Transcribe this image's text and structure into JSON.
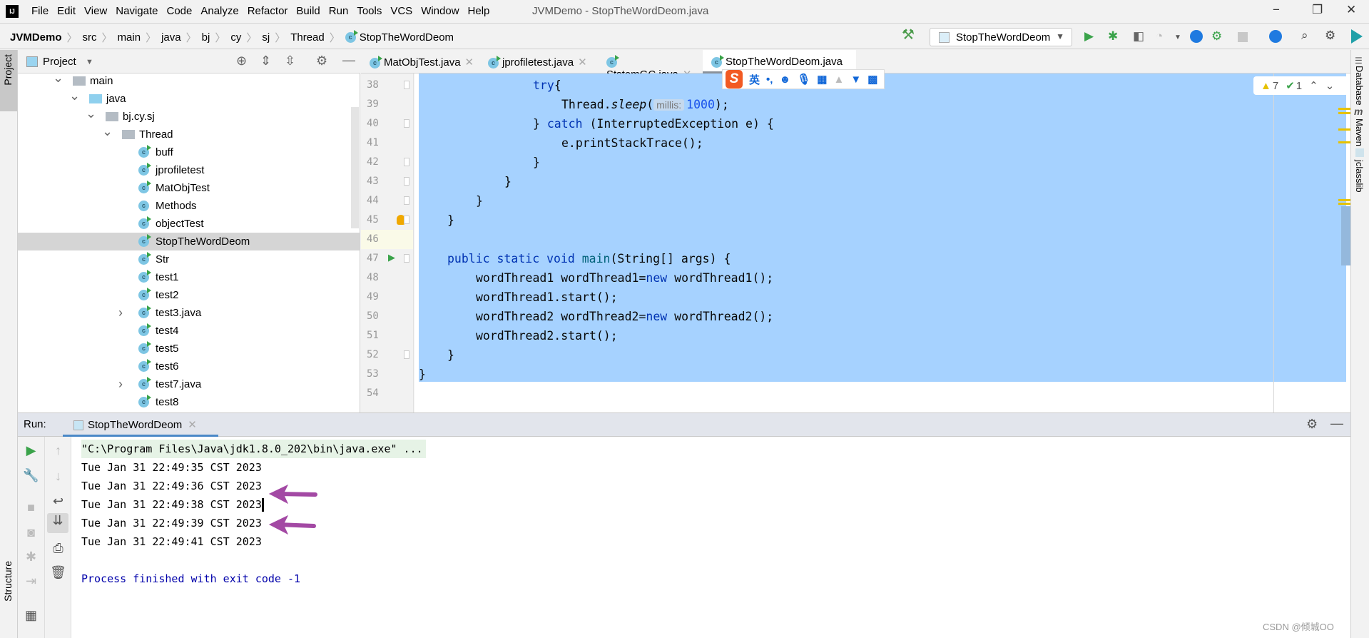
{
  "app": {
    "logo": "IJ",
    "title": "JVMDemo - StopTheWordDeom.java"
  },
  "menu": [
    "File",
    "Edit",
    "View",
    "Navigate",
    "Code",
    "Analyze",
    "Refactor",
    "Build",
    "Run",
    "Tools",
    "VCS",
    "Window",
    "Help"
  ],
  "window_controls": {
    "minimize": "−",
    "restore": "❐",
    "close": "✕"
  },
  "breadcrumb": [
    "JVMDemo",
    "src",
    "main",
    "java",
    "bj",
    "cy",
    "sj",
    "Thread",
    "StopTheWordDeom"
  ],
  "toolbar": {
    "run_config": "StopTheWordDeom",
    "icons": [
      "hammer-icon",
      "run-icon",
      "debug-icon",
      "coverage-icon",
      "profile-icon",
      "stop-icon",
      "search-icon",
      "gear-icon"
    ]
  },
  "left_strip": {
    "project": "Project",
    "structure": "Structure"
  },
  "project": {
    "title": "Project",
    "tree": [
      {
        "label": "main",
        "level": 0,
        "type": "folder",
        "expanded": true
      },
      {
        "label": "java",
        "level": 1,
        "type": "src",
        "expanded": true
      },
      {
        "label": "bj.cy.sj",
        "level": 2,
        "type": "package",
        "expanded": true
      },
      {
        "label": "Thread",
        "level": 3,
        "type": "package",
        "expanded": true
      },
      {
        "label": "buff",
        "level": 4,
        "type": "class"
      },
      {
        "label": "jprofiletest",
        "level": 4,
        "type": "class"
      },
      {
        "label": "MatObjTest",
        "level": 4,
        "type": "class"
      },
      {
        "label": "Methods",
        "level": 4,
        "type": "plain"
      },
      {
        "label": "objectTest",
        "level": 4,
        "type": "class"
      },
      {
        "label": "StopTheWordDeom",
        "level": 4,
        "type": "class",
        "selected": true
      },
      {
        "label": "Str",
        "level": 4,
        "type": "class"
      },
      {
        "label": "test1",
        "level": 4,
        "type": "class"
      },
      {
        "label": "test2",
        "level": 4,
        "type": "class"
      },
      {
        "label": "test3.java",
        "level": 4,
        "type": "class",
        "collapsed": true
      },
      {
        "label": "test4",
        "level": 4,
        "type": "class"
      },
      {
        "label": "test5",
        "level": 4,
        "type": "class"
      },
      {
        "label": "test6",
        "level": 4,
        "type": "class"
      },
      {
        "label": "test7.java",
        "level": 4,
        "type": "class",
        "collapsed": true
      },
      {
        "label": "test8",
        "level": 4,
        "type": "class"
      }
    ]
  },
  "editor": {
    "tabs": [
      {
        "label": "MatObjTest.java",
        "active": false
      },
      {
        "label": "jprofiletest.java",
        "active": false
      },
      {
        "label": "StstemGC.java",
        "active": false
      },
      {
        "label": "StopTheWordDeom.java",
        "active": true
      }
    ],
    "ime_bar": {
      "mode": "英",
      "punct": "•,"
    },
    "inspections": {
      "warnings": "7",
      "weak_warnings": "1"
    },
    "lines": [
      {
        "n": "38",
        "indent": 4,
        "tokens": [
          [
            "kw",
            "try"
          ],
          [
            "",
            "{"
          ]
        ]
      },
      {
        "n": "39",
        "indent": 5,
        "tokens": [
          [
            "",
            "Thread."
          ],
          [
            "it",
            "sleep"
          ],
          [
            "",
            "("
          ],
          [
            "hint",
            "millis:"
          ],
          [
            "num",
            "1000"
          ],
          [
            "",
            ");"
          ]
        ]
      },
      {
        "n": "40",
        "indent": 4,
        "tokens": [
          [
            "",
            "} "
          ],
          [
            "kw",
            "catch"
          ],
          [
            "",
            " (InterruptedException e) {"
          ]
        ]
      },
      {
        "n": "41",
        "indent": 5,
        "tokens": [
          [
            "",
            "e.printStackTrace();"
          ]
        ]
      },
      {
        "n": "42",
        "indent": 4,
        "tokens": [
          [
            "",
            "}"
          ]
        ]
      },
      {
        "n": "43",
        "indent": 3,
        "tokens": [
          [
            "",
            "}"
          ]
        ]
      },
      {
        "n": "44",
        "indent": 2,
        "tokens": [
          [
            "",
            "}"
          ]
        ]
      },
      {
        "n": "45",
        "indent": 1,
        "tokens": [
          [
            "",
            "}"
          ]
        ]
      },
      {
        "n": "46",
        "indent": 0,
        "tokens": []
      },
      {
        "n": "47",
        "indent": 1,
        "tokens": [
          [
            "kw",
            "public static void "
          ],
          [
            "fn",
            "main"
          ],
          [
            "",
            "(String[] args) {"
          ]
        ]
      },
      {
        "n": "48",
        "indent": 2,
        "tokens": [
          [
            "",
            "wordThread1 wordThread1="
          ],
          [
            "kw",
            "new"
          ],
          [
            "",
            " wordThread1();"
          ]
        ]
      },
      {
        "n": "49",
        "indent": 2,
        "tokens": [
          [
            "",
            "wordThread1.start();"
          ]
        ]
      },
      {
        "n": "50",
        "indent": 2,
        "tokens": [
          [
            "",
            "wordThread2 wordThread2="
          ],
          [
            "kw",
            "new"
          ],
          [
            "",
            " wordThread2();"
          ]
        ]
      },
      {
        "n": "51",
        "indent": 2,
        "tokens": [
          [
            "",
            "wordThread2.start();"
          ]
        ]
      },
      {
        "n": "52",
        "indent": 1,
        "tokens": [
          [
            "",
            "}"
          ]
        ]
      },
      {
        "n": "53",
        "indent": 0,
        "tokens": [
          [
            "",
            "}"
          ]
        ]
      },
      {
        "n": "54",
        "indent": 0,
        "tokens": []
      }
    ]
  },
  "right_strip": [
    "Database",
    "Maven",
    "jclasslib"
  ],
  "run": {
    "label": "Run:",
    "tab": "StopTheWordDeom",
    "console": [
      {
        "text": "\"C:\\Program Files\\Java\\jdk1.8.0_202\\bin\\java.exe\" ...",
        "kind": "cmd"
      },
      {
        "text": "Tue Jan 31 22:49:35 CST 2023",
        "kind": "out"
      },
      {
        "text": "Tue Jan 31 22:49:36 CST 2023",
        "kind": "out"
      },
      {
        "text": "Tue Jan 31 22:49:38 CST 2023",
        "kind": "out",
        "caret": true
      },
      {
        "text": "Tue Jan 31 22:49:39 CST 2023",
        "kind": "out"
      },
      {
        "text": "Tue Jan 31 22:49:41 CST 2023",
        "kind": "out"
      },
      {
        "text": "",
        "kind": "out"
      },
      {
        "text": "Process finished with exit code -1",
        "kind": "exit"
      }
    ],
    "annotation_color": "#a349a4"
  },
  "watermark": "CSDN @倾城OO",
  "colors": {
    "selection": "#a6d2ff",
    "keyword": "#0033b3",
    "run_green": "#3aa34a",
    "tab_underline": "#4a88c7"
  }
}
